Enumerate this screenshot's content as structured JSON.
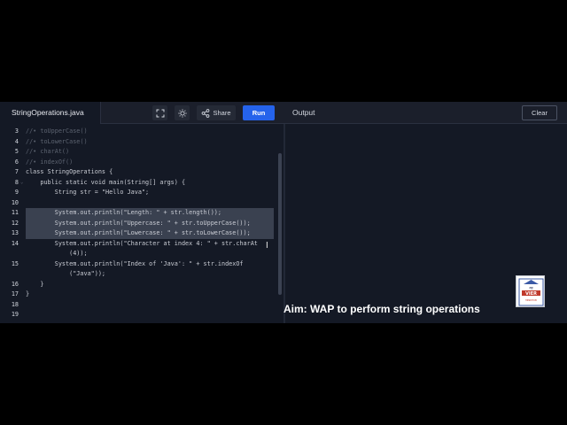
{
  "editor": {
    "filename": "StringOperations.java",
    "lines": [
      {
        "n": "3",
        "text": "//• toUpperCase()",
        "kind": "comment"
      },
      {
        "n": "4",
        "text": "//• toLowerCase()",
        "kind": "comment"
      },
      {
        "n": "5",
        "text": "//• charAt()",
        "kind": "comment"
      },
      {
        "n": "6",
        "text": "//• indexOf()",
        "kind": "comment"
      },
      {
        "n": "7",
        "text": "class StringOperations {",
        "kind": "code"
      },
      {
        "n": "8",
        "text": "    public static void main(String[] args) {",
        "kind": "code"
      },
      {
        "n": "9",
        "text": "        String str = \"Hello Java\";",
        "kind": "code"
      },
      {
        "n": "10",
        "text": "",
        "kind": "code"
      },
      {
        "n": "11",
        "text": "        System.out.println(\"Length: \" + str.length());",
        "kind": "code"
      },
      {
        "n": "12",
        "text": "        System.out.println(\"Uppercase: \" + str.toUpperCase());",
        "kind": "code"
      },
      {
        "n": "13",
        "text": "        System.out.println(\"Lowercase: \" + str.toLowerCase());",
        "kind": "code"
      },
      {
        "n": "14",
        "text": "        System.out.println(\"Character at index 4: \" + str.charAt",
        "kind": "code"
      },
      {
        "n": "",
        "text": "            (4));",
        "kind": "code"
      },
      {
        "n": "15",
        "text": "        System.out.println(\"Index of 'Java': \" + str.indexOf",
        "kind": "code"
      },
      {
        "n": "",
        "text": "            (\"Java\"));",
        "kind": "code"
      },
      {
        "n": "16",
        "text": "    }",
        "kind": "code"
      },
      {
        "n": "17",
        "text": "}",
        "kind": "code"
      },
      {
        "n": "18",
        "text": "",
        "kind": "code"
      },
      {
        "n": "19",
        "text": "",
        "kind": "code"
      }
    ]
  },
  "toolbar": {
    "fullscreen_icon": "fullscreen-icon",
    "theme_icon": "sun-icon",
    "share_label": "Share",
    "run_label": "Run"
  },
  "output": {
    "label": "Output",
    "clear_label": "Clear"
  },
  "caption": "Aim: WAP to perform string operations",
  "logo": {
    "top_text": "वह",
    "main_text": "VIER",
    "bottom_text": "MINDHUB"
  },
  "colors": {
    "run_button": "#2563eb",
    "panel_bg": "#141925",
    "page_bg": "#000000"
  }
}
